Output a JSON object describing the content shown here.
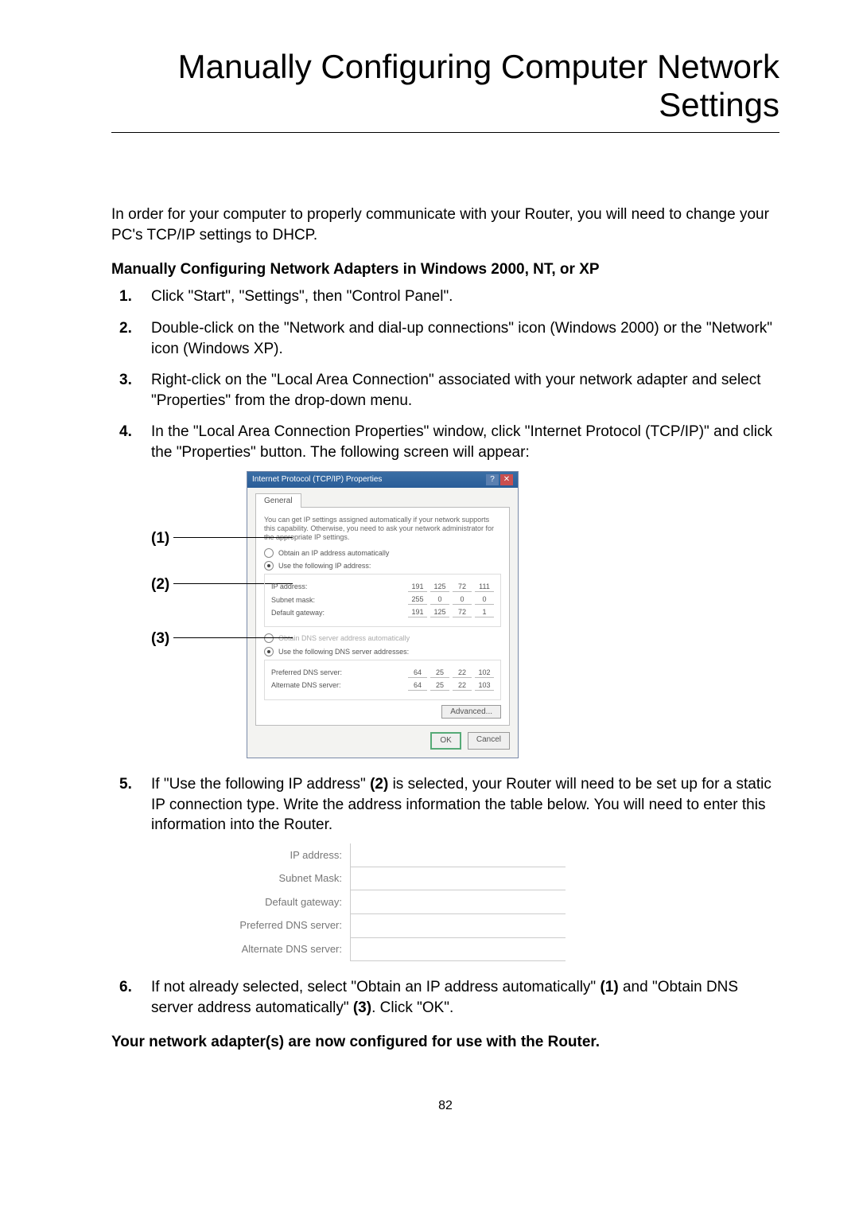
{
  "page_title": "Manually Configuring Computer Network Settings",
  "intro": "In order for your computer to properly communicate with your Router, you will need to change your PC's TCP/IP settings to DHCP.",
  "subhead": "Manually Configuring Network Adapters in Windows 2000, NT, or XP",
  "steps": {
    "s1": "Click \"Start\", \"Settings\", then \"Control Panel\".",
    "s2": "Double-click on the \"Network and dial-up connections\" icon (Windows 2000) or the \"Network\" icon (Windows XP).",
    "s3": "Right-click on the \"Local Area Connection\" associated with your network adapter and select \"Properties\" from the drop-down menu.",
    "s4": "In the \"Local Area Connection Properties\" window, click \"Internet Protocol (TCP/IP)\" and click the \"Properties\" button. The following screen will appear:",
    "s5_a": "If \"Use the following IP address\" ",
    "s5_b": "(2)",
    "s5_c": " is selected, your Router will need to be set up for a static IP connection type. Write the address information the table below. You will need to enter this information into the Router.",
    "s6_a": "If not already selected, select \"Obtain an IP address automatically\" ",
    "s6_b": "(1)",
    "s6_c": " and \"Obtain DNS server address automatically\" ",
    "s6_d": "(3)",
    "s6_e": ". Click \"OK\"."
  },
  "callouts": {
    "c1": "(1)",
    "c2": "(2)",
    "c3": "(3)"
  },
  "dialog": {
    "title": "Internet Protocol (TCP/IP) Properties",
    "tab": "General",
    "description": "You can get IP settings assigned automatically if your network supports this capability. Otherwise, you need to ask your network administrator for the appropriate IP settings.",
    "radio_auto_ip": "Obtain an IP address automatically",
    "radio_use_ip": "Use the following IP address:",
    "lbl_ip": "IP address:",
    "lbl_mask": "Subnet mask:",
    "lbl_gw": "Default gateway:",
    "radio_auto_dns": "Obtain DNS server address automatically",
    "radio_use_dns": "Use the following DNS server addresses:",
    "lbl_pdns": "Preferred DNS server:",
    "lbl_adns": "Alternate DNS server:",
    "ip_octets": [
      "191",
      "125",
      "72",
      "111"
    ],
    "mask_octets": [
      "255",
      "0",
      "0",
      "0"
    ],
    "gw_octets": [
      "191",
      "125",
      "72",
      "1"
    ],
    "pdns_octets": [
      "64",
      "25",
      "22",
      "102"
    ],
    "adns_octets": [
      "64",
      "25",
      "22",
      "103"
    ],
    "btn_adv": "Advanced...",
    "btn_ok": "OK",
    "btn_cancel": "Cancel"
  },
  "ip_table": {
    "row1": "IP address:",
    "row2": "Subnet Mask:",
    "row3": "Default gateway:",
    "row4": "Preferred DNS server:",
    "row5": "Alternate DNS server:"
  },
  "closing": "Your network adapter(s) are now configured for use with the Router.",
  "page_number": "82"
}
